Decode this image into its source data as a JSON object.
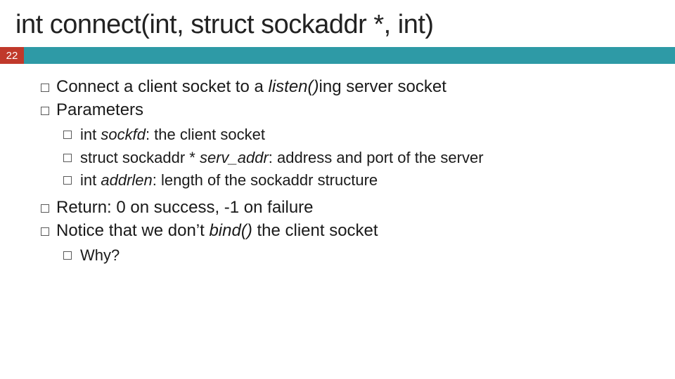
{
  "title": "int connect(int, struct sockaddr *, int)",
  "page_number": "22",
  "bullets": {
    "b1_pre": "Connect a client socket to a ",
    "b1_it": "listen()",
    "b1_post": "ing server socket",
    "b2": "Parameters",
    "b2_1_pre": "int ",
    "b2_1_it": "sockfd",
    "b2_1_post": ": the client socket",
    "b2_2_pre": "struct sockaddr * ",
    "b2_2_it": "serv_addr",
    "b2_2_post": ": address and port of the server",
    "b2_3_pre": "int ",
    "b2_3_it": "addrlen",
    "b2_3_post": ": length of the sockaddr structure",
    "b3": "Return: 0 on success, -1 on failure",
    "b4_pre": "Notice that we don’t ",
    "b4_it": "bind()",
    "b4_post": " the client socket",
    "b4_1": "Why?"
  }
}
